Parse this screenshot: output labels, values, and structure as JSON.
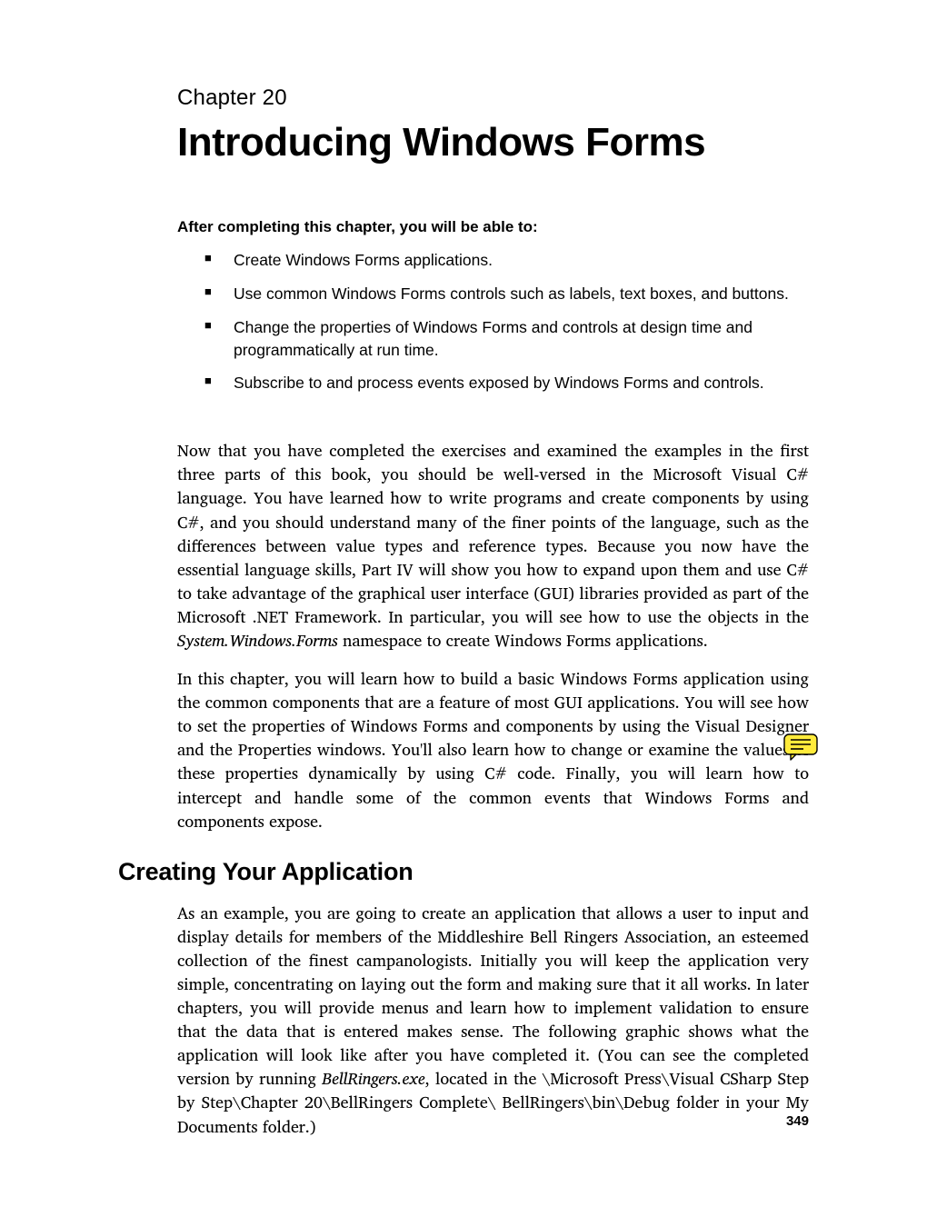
{
  "chapter_label": "Chapter 20",
  "chapter_title": "Introducing Windows Forms",
  "objectives_intro": "After completing this chapter, you will be able to:",
  "objectives": [
    "Create Windows Forms applications.",
    "Use common Windows Forms controls such as labels, text boxes, and buttons.",
    "Change the properties of Windows Forms and controls at design time and programmatically at run time.",
    "Subscribe to and process events exposed by Windows Forms and controls."
  ],
  "para1_pre": "Now that you have completed the exercises and examined the examples in the first three parts of this book, you should be well-versed in the Microsoft Visual C# language. You have learned how to write programs and create components by using C#, and you should understand many of the finer points of the language, such as the differences between value types and reference types. Because you now have the essential language skills, Part IV will show you how to expand upon them and use C# to take advantage of the graphical user interface (GUI) libraries provided as part of the Microsoft .NET Framework. In particular, you will see how to use the objects in the ",
  "para1_italic": "System.Windows.Forms",
  "para1_post": " namespace to create Windows Forms applications.",
  "para2": "In this chapter, you will learn how to build a basic Windows Forms application using the common components that are a feature of most GUI applications. You will see how to set the properties of Windows Forms and components by using the Visual Designer and the Properties windows. You'll also learn how to change or examine the values of these properties dynamically by using C# code. Finally, you will learn how to intercept and handle some of the common events that Windows Forms and components expose.",
  "section_heading": "Creating Your Application",
  "para3_pre": "As an example, you are going to create an application that allows a user to input and display details for members of the Middleshire Bell Ringers Association, an esteemed collection of the finest campanologists. Initially you will keep the application very simple, concentrating on laying out the form and making sure that it all works. In later chapters, you will provide menus and learn how to implement validation to ensure that the data that is entered makes sense. The following graphic shows what the application will look like after you have completed it. (You can see the completed version by running ",
  "para3_italic": "BellRingers.exe",
  "para3_post": ", located in the \\Microsoft Press\\Visual CSharp Step by Step\\Chapter 20\\BellRingers Complete\\ BellRingers\\bin\\Debug folder in your My Documents folder.)",
  "page_number": "349",
  "note_icon_name": "note-icon"
}
